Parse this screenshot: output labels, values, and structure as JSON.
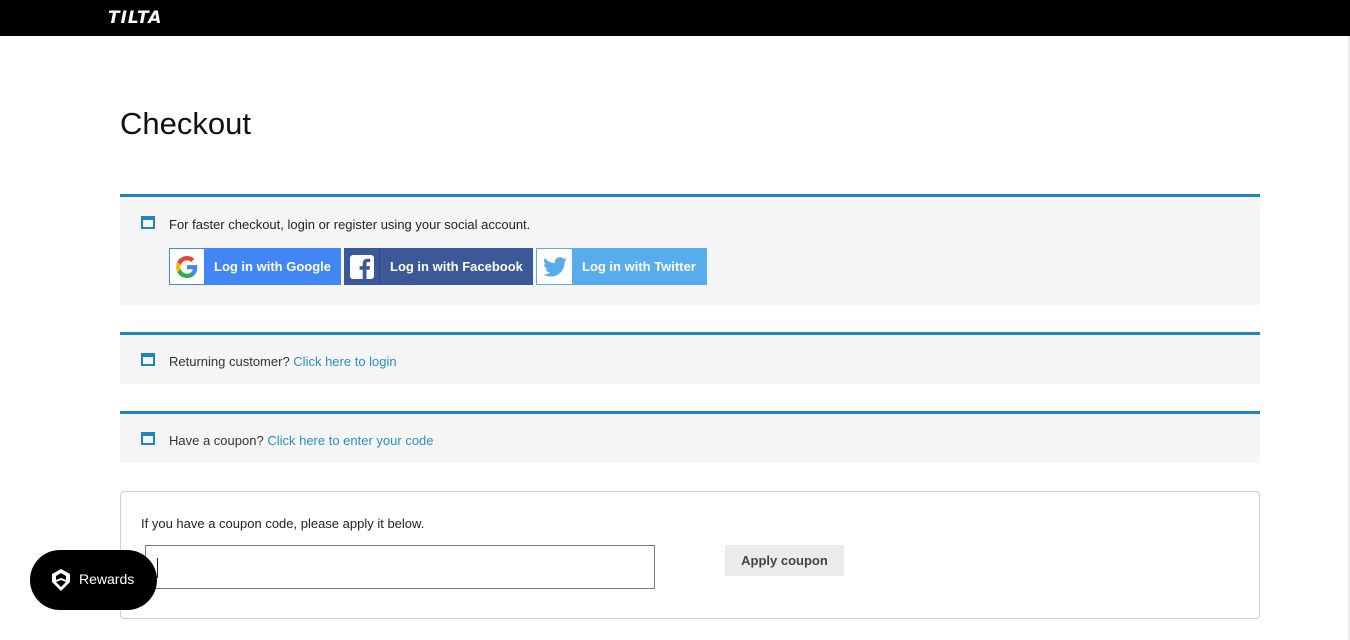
{
  "header": {
    "logo_text": "TILTA"
  },
  "page": {
    "title": "Checkout"
  },
  "social_notice": {
    "text": "For faster checkout, login or register using your social account.",
    "buttons": {
      "google": "Log in with Google",
      "facebook": "Log in with Facebook",
      "twitter": "Log in with Twitter"
    }
  },
  "login_notice": {
    "text": "Returning customer?",
    "link": "Click here to login"
  },
  "coupon_notice": {
    "text": "Have a coupon?",
    "link": "Click here to enter your code"
  },
  "coupon_form": {
    "description": "If you have a coupon code, please apply it below.",
    "input_value": "",
    "apply_label": "Apply coupon"
  },
  "rewards": {
    "label": "Rewards"
  },
  "colors": {
    "accent": "#1e85be",
    "link": "#2a8fc9",
    "google": "#4286f5",
    "facebook": "#3b5898",
    "twitter": "#57acee"
  },
  "icons": {
    "notice": "window-icon",
    "google": "google-g-icon",
    "facebook": "facebook-f-icon",
    "twitter": "twitter-bird-icon",
    "rewards": "rewards-badge-icon"
  }
}
